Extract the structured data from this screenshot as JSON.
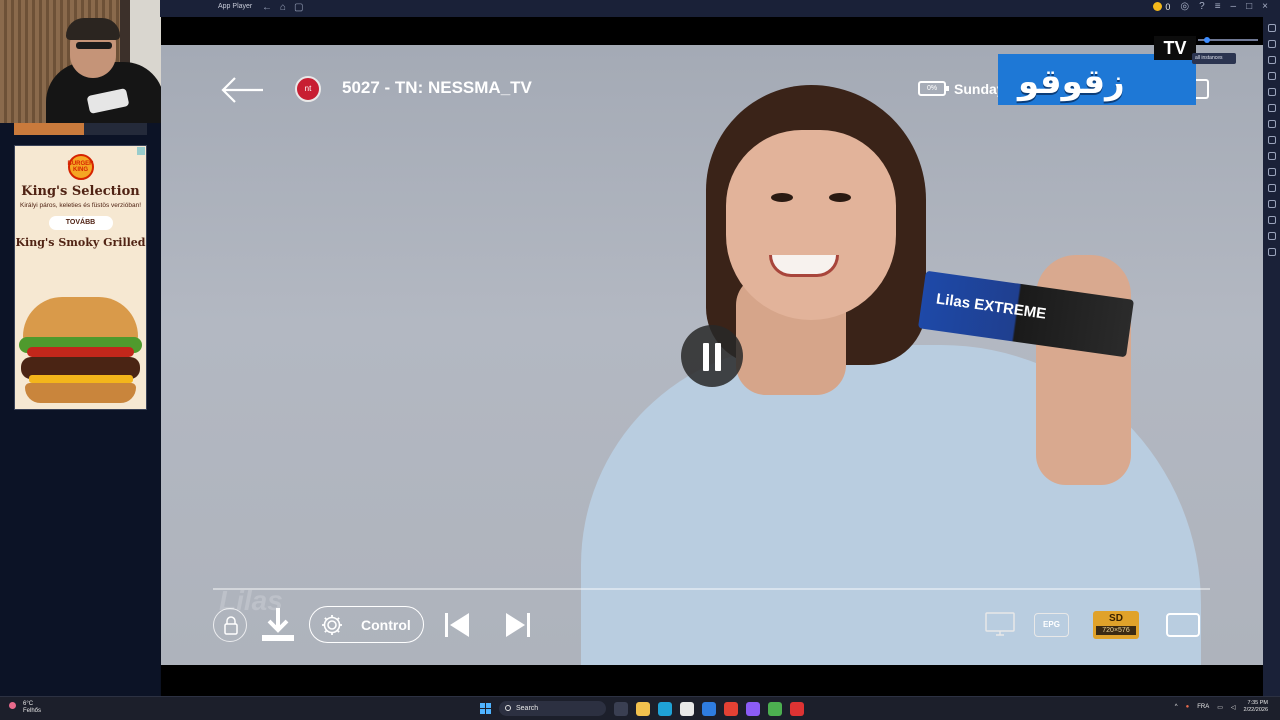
{
  "window": {
    "app_name": "App Player"
  },
  "titlebar": {
    "coins": "0"
  },
  "tooltip": "all instances",
  "player": {
    "channel_title": "5027 - TN: NESSMA_TV",
    "channel_logo_text": "nt",
    "battery": "0%",
    "day": "Sunday",
    "tv_logo_arabic": "زقوقو",
    "tv_logo_badge": "TV",
    "control_label": "Control",
    "epg_label": "EPG",
    "quality_label": "SD",
    "resolution": "720×576",
    "video_brand": "Lilas",
    "product_text": "Lilas EXTREME"
  },
  "ad": {
    "brand": "BURGER KING",
    "title": "King's Selection",
    "subtitle": "Királyi páros, keleties és füstös verzióban!",
    "button": "TOVÁBB",
    "product": "King's Smoky Grilled"
  },
  "taskbar": {
    "weather_temp": "6°C",
    "weather_desc": "Felhős",
    "search_placeholder": "Search",
    "lang": "FRA",
    "time": "7:35 PM",
    "date": "2/22/2026"
  },
  "colors": {
    "accent": "#1e78d6",
    "quality_badge": "#e0a22a",
    "channel_logo": "#c81e32"
  }
}
